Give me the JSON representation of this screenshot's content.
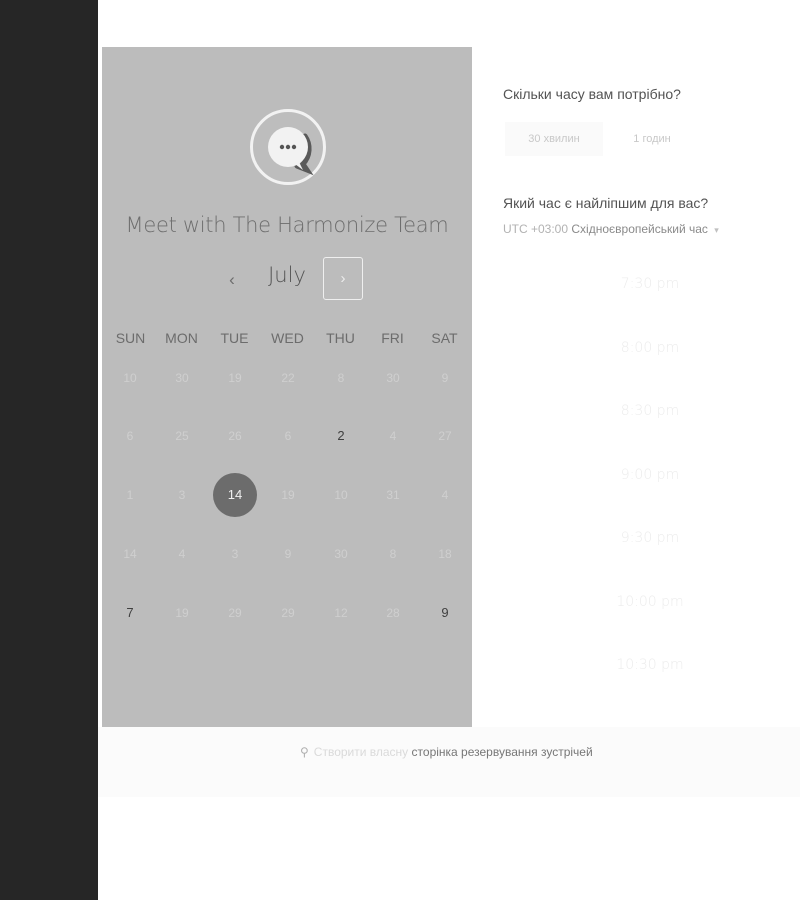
{
  "calendar": {
    "title": "Meet with The Harmonize Team",
    "month": "July",
    "prev_icon": "‹",
    "next_icon": "›",
    "weekdays": [
      "SUN",
      "MON",
      "TUE",
      "WED",
      "THU",
      "FRI",
      "SAT"
    ],
    "weeks": [
      [
        {
          "d": "10"
        },
        {
          "d": "30"
        },
        {
          "d": "19"
        },
        {
          "d": "22"
        },
        {
          "d": "8"
        },
        {
          "d": "30"
        },
        {
          "d": "9"
        }
      ],
      [
        {
          "d": "6"
        },
        {
          "d": "25"
        },
        {
          "d": "26"
        },
        {
          "d": "6"
        },
        {
          "d": "2",
          "s": "avail"
        },
        {
          "d": "4"
        },
        {
          "d": "27"
        }
      ],
      [
        {
          "d": "1"
        },
        {
          "d": "3"
        },
        {
          "d": "14",
          "s": "sel"
        },
        {
          "d": "19"
        },
        {
          "d": "10"
        },
        {
          "d": "31"
        },
        {
          "d": "4"
        }
      ],
      [
        {
          "d": "14"
        },
        {
          "d": "4"
        },
        {
          "d": "3"
        },
        {
          "d": "9"
        },
        {
          "d": "30"
        },
        {
          "d": "8"
        },
        {
          "d": "18"
        }
      ],
      [
        {
          "d": "7",
          "s": "avail"
        },
        {
          "d": "19"
        },
        {
          "d": "29"
        },
        {
          "d": "29"
        },
        {
          "d": "12"
        },
        {
          "d": "28"
        },
        {
          "d": "9",
          "s": "avail"
        }
      ]
    ]
  },
  "duration": {
    "question": "Скільки часу вам потрібно?",
    "options": [
      "30 хвилин",
      "1 годин"
    ],
    "selected_index": 0
  },
  "time": {
    "question": "Який час є найліпшим для вас?",
    "tz_offset": "UTC +03:00",
    "tz_name": "Східноєвропейський час",
    "tz_caret": "▾",
    "slots": [
      "7:30 pm",
      "8:00 pm",
      "8:30 pm",
      "9:00 pm",
      "9:30 pm",
      "10:00 pm",
      "10:30 pm"
    ]
  },
  "footer": {
    "icon_glyph": "⚲",
    "light_text": "Створити власну",
    "strong_text": "сторінка резервування зустрічей"
  }
}
